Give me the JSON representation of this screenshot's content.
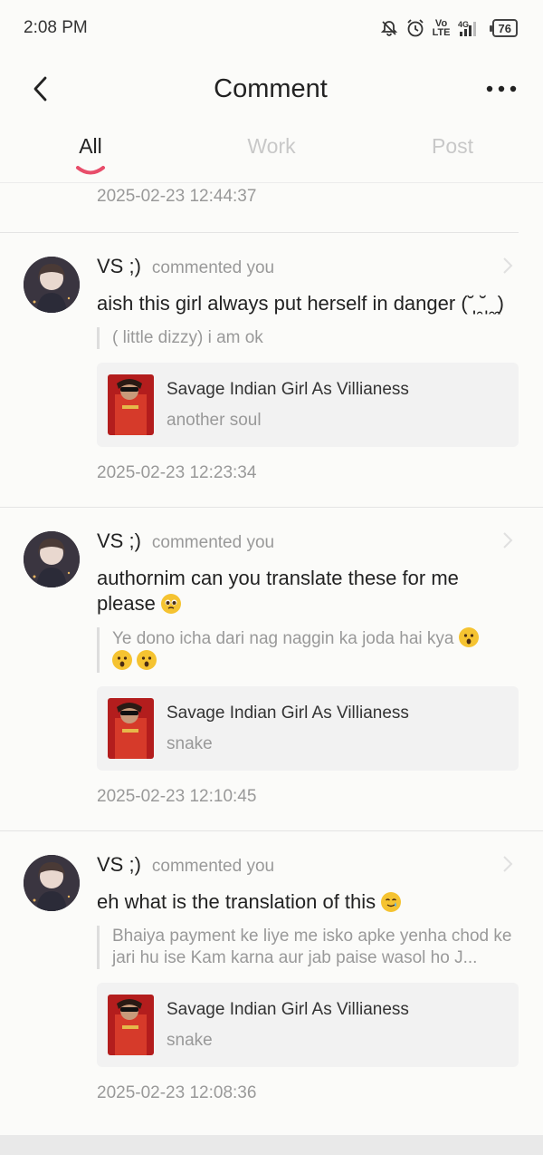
{
  "status_bar": {
    "time": "2:08 PM",
    "battery": "76",
    "network": "4G",
    "volte": "Vo\nLTE"
  },
  "header": {
    "title": "Comment"
  },
  "tabs": [
    {
      "label": "All",
      "active": true
    },
    {
      "label": "Work",
      "active": false
    },
    {
      "label": "Post",
      "active": false
    }
  ],
  "first_timestamp": "2025-02-23 12:44:37",
  "comments": [
    {
      "username": "VS ;)",
      "action": "commented you",
      "text": "aish this girl always put herself in danger (˘̩̩̩ ̯˘̩̩̩ ̯ ̯)",
      "quote": "( little dizzy) i am ok",
      "book_title": "Savage Indian Girl As Villianess",
      "chapter": "another soul",
      "time": "2025-02-23 12:23:34"
    },
    {
      "username": "VS ;)",
      "action": "commented you",
      "text": "authornim can you translate these for me please",
      "quote": "Ye dono icha dari nag naggin ka joda  hai  kya",
      "book_title": "Savage Indian Girl As Villianess",
      "chapter": "snake",
      "time": "2025-02-23 12:10:45"
    },
    {
      "username": "VS ;)",
      "action": "commented you",
      "text": "eh what is the translation of this",
      "quote": "Bhaiya payment ke liye me isko apke yenha chod ke jari hu ise Kam karna aur jab paise wasol ho J...",
      "book_title": "Savage Indian Girl As Villianess",
      "chapter": "snake",
      "time": "2025-02-23 12:08:36"
    }
  ],
  "colors": {
    "accent": "#e84d6a",
    "muted": "#999999",
    "card_bg": "#f2f2f2"
  }
}
